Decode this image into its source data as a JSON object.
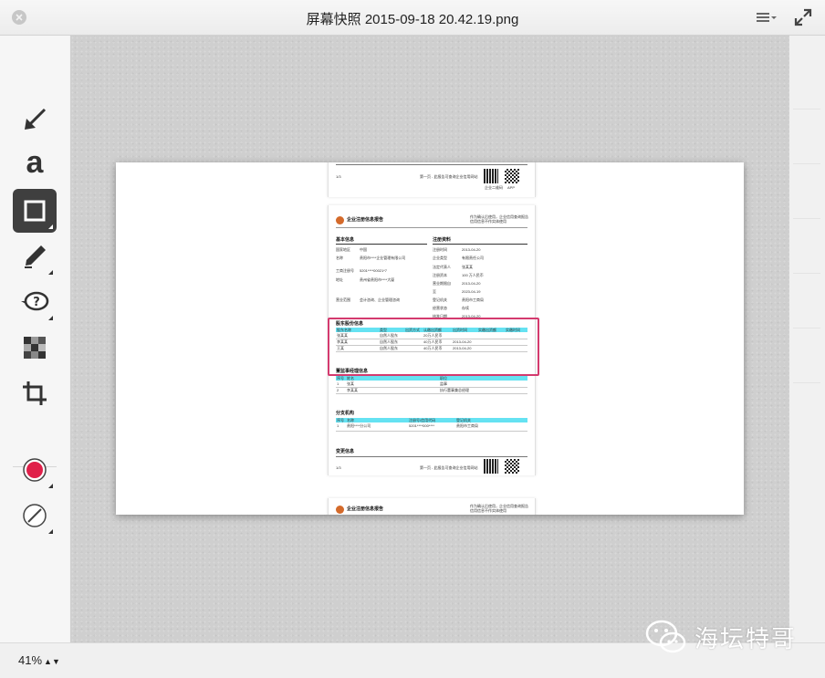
{
  "window": {
    "title": "屏幕快照 2015-09-18 20.42.19.png"
  },
  "toolbar": {
    "tools": [
      {
        "name": "arrow-tool",
        "icon": "arrow-icon"
      },
      {
        "name": "text-tool",
        "icon": "text-icon",
        "label": "a"
      },
      {
        "name": "rectangle-tool",
        "icon": "rectangle-icon",
        "active": true
      },
      {
        "name": "highlighter-tool",
        "icon": "pen-icon"
      },
      {
        "name": "callout-tool",
        "icon": "speech-bubble-icon",
        "label": "?"
      },
      {
        "name": "pixelate-tool",
        "icon": "pixelate-icon"
      },
      {
        "name": "crop-tool",
        "icon": "crop-icon"
      },
      {
        "name": "color-tool",
        "icon": "color-circle-icon",
        "color": "#e0204a"
      },
      {
        "name": "line-width-tool",
        "icon": "line-width-icon"
      }
    ]
  },
  "document": {
    "page1": {
      "page_no": "1/3",
      "footer_title": "第一页 - 此报告可查询企业信用网站",
      "qr_label": "企业二维码",
      "app_label": "APP"
    },
    "page2": {
      "brand": "企业注册信息报告",
      "header_right": "作为确认后使用，企业信用查询报告\n信用信息不作实体使用",
      "basic_title": "基本信息",
      "reg_title": "注册资料",
      "basic_rows": [
        {
          "k": "国家地区",
          "v": "中国"
        },
        {
          "k": "名称",
          "v": "贵阳市****企业管理有限公司"
        },
        {
          "k": "工商注册号",
          "v": "5201****00021*7"
        },
        {
          "k": "地址",
          "v": "贵州省贵阳市****大厦"
        },
        {
          "k": "营业范围",
          "v": "会计咨询、企业管理咨询"
        }
      ],
      "reg_rows": [
        {
          "k": "注册时间",
          "v": "2013-04-20"
        },
        {
          "k": "企业类型",
          "v": "有限责任公司"
        },
        {
          "k": "法定代表人",
          "v": "张某某"
        },
        {
          "k": "注册资本",
          "v": "100 万人民币"
        },
        {
          "k": "营业期限自",
          "v": "2013-04-20"
        },
        {
          "k": "至",
          "v": "2023-04-19"
        },
        {
          "k": "登记机关",
          "v": "贵阳市工商局"
        },
        {
          "k": "经营状态",
          "v": "存续"
        },
        {
          "k": "核准日期",
          "v": "2013-04-20"
        }
      ],
      "shareholder_title": "股东股份信息",
      "shareholder_cols": [
        "股东名称",
        "类型",
        "出资方式",
        "认缴出资额",
        "出资时间",
        "实缴出资额",
        "实缴时间"
      ],
      "shareholder_rows": [
        [
          "张某某",
          "自然人股东",
          "",
          "20万人民币",
          "",
          "",
          ""
        ],
        [
          "李某某",
          "自然人股东",
          "",
          "40万人民币",
          "2013-04-20",
          "",
          ""
        ],
        [
          "王某",
          "自然人股东",
          "",
          "40万人民币",
          "2013-04-20",
          "",
          ""
        ]
      ],
      "staff_title": "董监事经理信息",
      "staff_cols": [
        "序号",
        "姓名",
        "职位"
      ],
      "staff_rows": [
        [
          "1",
          "张某",
          "监事"
        ],
        [
          "2",
          "李某某",
          "执行董事兼总经理"
        ]
      ],
      "branch_title": "分支机构",
      "branch_cols": [
        "序号",
        "名称",
        "注册号/信用代码",
        "登记机关"
      ],
      "branch_rows": [
        [
          "1",
          "贵阳****分公司",
          "5201****000****",
          "贵阳市工商局"
        ]
      ],
      "change_title": "变更信息",
      "page_no": "1/3",
      "footer_title": "第一页 - 此报告可查询企业信用网站",
      "qr_label": "企业二维码",
      "app_label": "APP"
    },
    "page3": {
      "brand": "企业注册信息报告",
      "header_right": "作为确认后使用，企业信用查询报告\n信用信息不作实体使用"
    }
  },
  "status": {
    "zoom": "41%"
  },
  "watermark": {
    "text": "海坛特哥"
  },
  "colors": {
    "highlight": "#d43a6e",
    "table_header": "#65e2f2",
    "active_tool": "#3f3f3f",
    "record": "#e0204a"
  }
}
